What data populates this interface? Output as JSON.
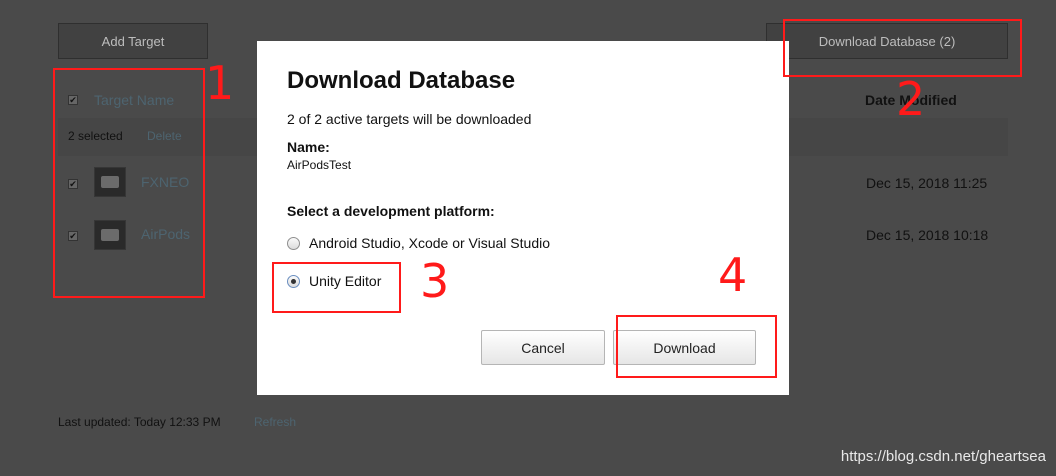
{
  "toolbar": {
    "add_target_label": "Add Target",
    "download_database_label": "Download Database (2)"
  },
  "table": {
    "columns": {
      "name": "Target Name",
      "date": "Date Modified"
    },
    "bulk": {
      "selected_count": "2 selected",
      "delete_label": "Delete"
    },
    "rows": [
      {
        "name": "FXNEO",
        "date": "Dec 15, 2018 11:25"
      },
      {
        "name": "AirPods",
        "date": "Dec 15, 2018 10:18"
      }
    ]
  },
  "footer": {
    "last_updated": "Last updated: Today 12:33 PM",
    "refresh_label": "Refresh"
  },
  "modal": {
    "title": "Download Database",
    "summary": "2 of 2 active targets will be downloaded",
    "name_label": "Name:",
    "name_value": "AirPodsTest",
    "platform_label": "Select a development platform:",
    "options": [
      {
        "label": "Android Studio, Xcode or Visual Studio",
        "selected": false
      },
      {
        "label": "Unity Editor",
        "selected": true
      }
    ],
    "cancel_label": "Cancel",
    "download_label": "Download"
  },
  "annotations": {
    "labels": [
      "1",
      "2",
      "3",
      "4"
    ],
    "color": "#ff1a1a"
  },
  "watermark": "https://blog.csdn.net/gheartsea"
}
